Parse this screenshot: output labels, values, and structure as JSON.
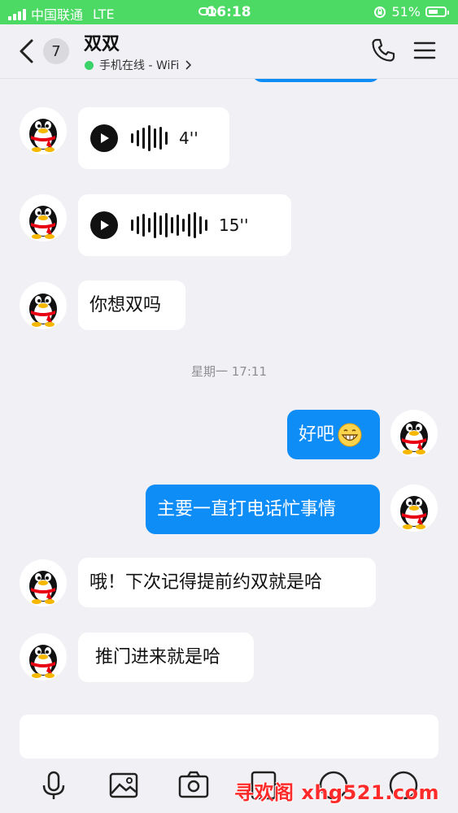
{
  "status_bar": {
    "carrier": "中国联通",
    "network": "LTE",
    "time": "16:18",
    "battery": "51%",
    "color": "#4cd964"
  },
  "header": {
    "unread_count": "7",
    "contact_name": "双双",
    "presence": "手机在线 - WiFi",
    "icons": [
      "chevron-left-icon",
      "phone-icon",
      "menu-icon"
    ]
  },
  "messages": [
    {
      "side": "in",
      "type": "voice",
      "duration": "4''"
    },
    {
      "side": "in",
      "type": "voice",
      "duration": "15''"
    },
    {
      "side": "in",
      "type": "text",
      "text": "你想双吗"
    },
    {
      "type": "time",
      "text": "星期一 17:11"
    },
    {
      "side": "out",
      "type": "text",
      "text": "好吧"
    },
    {
      "side": "out",
      "type": "text",
      "text": "主要一直打电话忙事情"
    },
    {
      "side": "in",
      "type": "text",
      "text": "哦！下次记得提前约双就是哈"
    },
    {
      "side": "in",
      "type": "text",
      "text": " 推门进来就是哈"
    }
  ],
  "composer": {
    "input_value": "",
    "toolbar": [
      "microphone-icon",
      "image-icon",
      "camera-icon",
      "file-icon",
      "emoji-icon",
      "more-icon"
    ]
  },
  "watermark": "寻欢阁 xhg521.com",
  "colors": {
    "outgoing_bubble": "#0f8df7",
    "incoming_bubble": "#ffffff",
    "background": "#f1f1f5"
  }
}
